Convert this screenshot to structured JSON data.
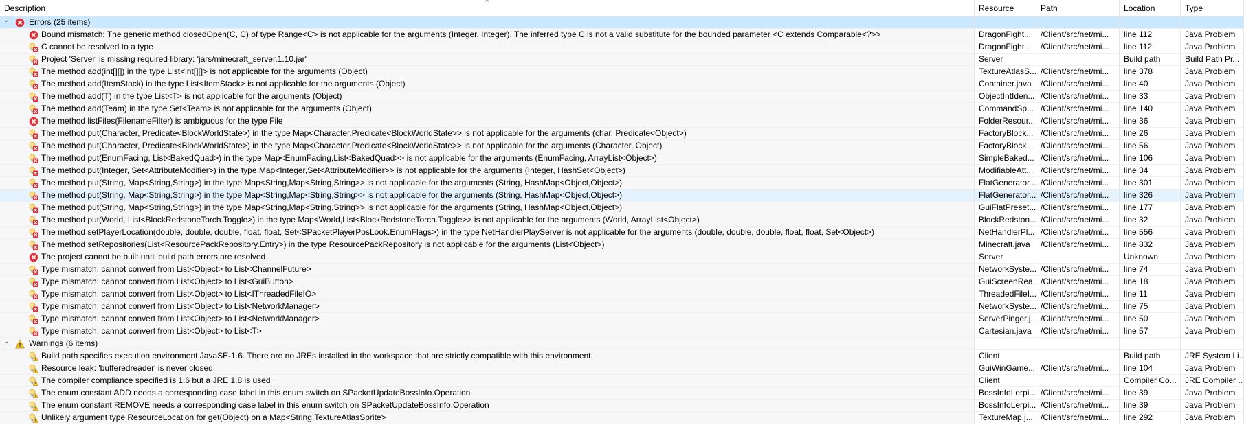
{
  "columns": [
    "Description",
    "Resource",
    "Path",
    "Location",
    "Type"
  ],
  "sort_indicator": "^",
  "groups": [
    {
      "label": "Errors (25 items)",
      "icon": "error-icon",
      "items": [
        {
          "icon": "error-icon",
          "description": "Bound mismatch: The generic method closedOpen(C, C) of type Range<C> is not applicable for the arguments (Integer, Integer). The inferred type C is not a valid substitute for the bounded parameter <C extends Comparable<?>>",
          "resource": "DragonFight...",
          "path": "/Client/src/net/mi...",
          "location": "line 112",
          "type": "Java Problem"
        },
        {
          "icon": "error-quickfix-icon",
          "description": "C cannot be resolved to a type",
          "resource": "DragonFight...",
          "path": "/Client/src/net/mi...",
          "location": "line 112",
          "type": "Java Problem"
        },
        {
          "icon": "error-quickfix-icon",
          "description": "Project 'Server' is missing required library: 'jars/minecraft_server.1.10.jar'",
          "resource": "Server",
          "path": "",
          "location": "Build path",
          "type": "Build Path Pr..."
        },
        {
          "icon": "error-quickfix-icon",
          "description": "The method add(int[][]) in the type List<int[][]> is not applicable for the arguments (Object)",
          "resource": "TextureAtlasS...",
          "path": "/Client/src/net/mi...",
          "location": "line 378",
          "type": "Java Problem"
        },
        {
          "icon": "error-quickfix-icon",
          "description": "The method add(ItemStack) in the type List<ItemStack> is not applicable for the arguments (Object)",
          "resource": "Container.java",
          "path": "/Client/src/net/mi...",
          "location": "line 40",
          "type": "Java Problem"
        },
        {
          "icon": "error-quickfix-icon",
          "description": "The method add(T) in the type List<T> is not applicable for the arguments (Object)",
          "resource": "ObjectIntIden...",
          "path": "/Client/src/net/mi...",
          "location": "line 33",
          "type": "Java Problem"
        },
        {
          "icon": "error-quickfix-icon",
          "description": "The method add(Team) in the type Set<Team> is not applicable for the arguments (Object)",
          "resource": "CommandSp...",
          "path": "/Client/src/net/mi...",
          "location": "line 140",
          "type": "Java Problem"
        },
        {
          "icon": "error-icon",
          "description": "The method listFiles(FilenameFilter) is ambiguous for the type File",
          "resource": "FolderResour...",
          "path": "/Client/src/net/mi...",
          "location": "line 36",
          "type": "Java Problem"
        },
        {
          "icon": "error-quickfix-icon",
          "description": "The method put(Character, Predicate<BlockWorldState>) in the type Map<Character,Predicate<BlockWorldState>> is not applicable for the arguments (char, Predicate<Object>)",
          "resource": "FactoryBlock...",
          "path": "/Client/src/net/mi...",
          "location": "line 26",
          "type": "Java Problem"
        },
        {
          "icon": "error-quickfix-icon",
          "description": "The method put(Character, Predicate<BlockWorldState>) in the type Map<Character,Predicate<BlockWorldState>> is not applicable for the arguments (Character, Object)",
          "resource": "FactoryBlock...",
          "path": "/Client/src/net/mi...",
          "location": "line 56",
          "type": "Java Problem"
        },
        {
          "icon": "error-quickfix-icon",
          "description": "The method put(EnumFacing, List<BakedQuad>) in the type Map<EnumFacing,List<BakedQuad>> is not applicable for the arguments (EnumFacing, ArrayList<Object>)",
          "resource": "SimpleBaked...",
          "path": "/Client/src/net/mi...",
          "location": "line 106",
          "type": "Java Problem"
        },
        {
          "icon": "error-quickfix-icon",
          "description": "The method put(Integer, Set<AttributeModifier>) in the type Map<Integer,Set<AttributeModifier>> is not applicable for the arguments (Integer, HashSet<Object>)",
          "resource": "ModifiableAtt...",
          "path": "/Client/src/net/mi...",
          "location": "line 34",
          "type": "Java Problem"
        },
        {
          "icon": "error-quickfix-icon",
          "description": "The method put(String, Map<String,String>) in the type Map<String,Map<String,String>> is not applicable for the arguments (String, HashMap<Object,Object>)",
          "resource": "FlatGenerator...",
          "path": "/Client/src/net/mi...",
          "location": "line 301",
          "type": "Java Problem"
        },
        {
          "icon": "error-quickfix-icon",
          "description": "The method put(String, Map<String,String>) in the type Map<String,Map<String,String>> is not applicable for the arguments (String, HashMap<Object,Object>)",
          "resource": "FlatGenerator...",
          "path": "/Client/src/net/mi...",
          "location": "line 326",
          "type": "Java Problem",
          "selected": true
        },
        {
          "icon": "error-quickfix-icon",
          "description": "The method put(String, Map<String,String>) in the type Map<String,Map<String,String>> is not applicable for the arguments (String, HashMap<Object,Object>)",
          "resource": "GuiFlatPreset...",
          "path": "/Client/src/net/mi...",
          "location": "line 177",
          "type": "Java Problem"
        },
        {
          "icon": "error-quickfix-icon",
          "description": "The method put(World, List<BlockRedstoneTorch.Toggle>) in the type Map<World,List<BlockRedstoneTorch.Toggle>> is not applicable for the arguments (World, ArrayList<Object>)",
          "resource": "BlockRedston...",
          "path": "/Client/src/net/mi...",
          "location": "line 32",
          "type": "Java Problem"
        },
        {
          "icon": "error-quickfix-icon",
          "description": "The method setPlayerLocation(double, double, double, float, float, Set<SPacketPlayerPosLook.EnumFlags>) in the type NetHandlerPlayServer is not applicable for the arguments (double, double, double, float, float, Set<Object>)",
          "resource": "NetHandlerPl...",
          "path": "/Client/src/net/mi...",
          "location": "line 556",
          "type": "Java Problem"
        },
        {
          "icon": "error-quickfix-icon",
          "description": "The method setRepositories(List<ResourcePackRepository.Entry>) in the type ResourcePackRepository is not applicable for the arguments (List<Object>)",
          "resource": "Minecraft.java",
          "path": "/Client/src/net/mi...",
          "location": "line 832",
          "type": "Java Problem"
        },
        {
          "icon": "error-icon",
          "description": "The project cannot be built until build path errors are resolved",
          "resource": "Server",
          "path": "",
          "location": "Unknown",
          "type": "Java Problem"
        },
        {
          "icon": "error-quickfix-icon",
          "description": "Type mismatch: cannot convert from List<Object> to List<ChannelFuture>",
          "resource": "NetworkSyste...",
          "path": "/Client/src/net/mi...",
          "location": "line 74",
          "type": "Java Problem"
        },
        {
          "icon": "error-quickfix-icon",
          "description": "Type mismatch: cannot convert from List<Object> to List<GuiButton>",
          "resource": "GuiScreenRea...",
          "path": "/Client/src/net/mi...",
          "location": "line 18",
          "type": "Java Problem"
        },
        {
          "icon": "error-quickfix-icon",
          "description": "Type mismatch: cannot convert from List<Object> to List<IThreadedFileIO>",
          "resource": "ThreadedFileI...",
          "path": "/Client/src/net/mi...",
          "location": "line 11",
          "type": "Java Problem"
        },
        {
          "icon": "error-quickfix-icon",
          "description": "Type mismatch: cannot convert from List<Object> to List<NetworkManager>",
          "resource": "NetworkSyste...",
          "path": "/Client/src/net/mi...",
          "location": "line 75",
          "type": "Java Problem"
        },
        {
          "icon": "error-quickfix-icon",
          "description": "Type mismatch: cannot convert from List<Object> to List<NetworkManager>",
          "resource": "ServerPinger.j...",
          "path": "/Client/src/net/mi...",
          "location": "line 50",
          "type": "Java Problem"
        },
        {
          "icon": "error-quickfix-icon",
          "description": "Type mismatch: cannot convert from List<Object> to List<T>",
          "resource": "Cartesian.java",
          "path": "/Client/src/net/mi...",
          "location": "line 57",
          "type": "Java Problem"
        }
      ]
    },
    {
      "label": "Warnings (6 items)",
      "icon": "warning-icon",
      "items": [
        {
          "icon": "warning-quickfix-icon",
          "description": "Build path specifies execution environment JavaSE-1.6. There are no JREs installed in the workspace that are strictly compatible with this environment.",
          "resource": "Client",
          "path": "",
          "location": "Build path",
          "type": "JRE System Li..."
        },
        {
          "icon": "warning-quickfix-icon",
          "description": "Resource leak: 'bufferedreader' is never closed",
          "resource": "GuiWinGame....",
          "path": "/Client/src/net/mi...",
          "location": "line 104",
          "type": "Java Problem"
        },
        {
          "icon": "warning-quickfix-icon",
          "description": "The compiler compliance specified is 1.6 but a JRE 1.8 is used",
          "resource": "Client",
          "path": "",
          "location": "Compiler Co...",
          "type": "JRE Compiler ..."
        },
        {
          "icon": "warning-quickfix-icon",
          "description": "The enum constant ADD needs a corresponding case label in this enum switch on SPacketUpdateBossInfo.Operation",
          "resource": "BossInfoLerpi...",
          "path": "/Client/src/net/mi...",
          "location": "line 39",
          "type": "Java Problem"
        },
        {
          "icon": "warning-quickfix-icon",
          "description": "The enum constant REMOVE needs a corresponding case label in this enum switch on SPacketUpdateBossInfo.Operation",
          "resource": "BossInfoLerpi...",
          "path": "/Client/src/net/mi...",
          "location": "line 39",
          "type": "Java Problem"
        },
        {
          "icon": "warning-quickfix-icon",
          "description": "Unlikely argument type ResourceLocation for get(Object) on a Map<String,TextureAtlasSprite>",
          "resource": "TextureMap.j...",
          "path": "/Client/src/net/mi...",
          "location": "line 292",
          "type": "Java Problem"
        }
      ]
    }
  ],
  "colors": {
    "group_selected": "#cce8ff",
    "row_selected": "#e5f3ff",
    "sorted_column": "#f7f7f7",
    "error": "#e0303a",
    "warning": "#f2c230"
  }
}
